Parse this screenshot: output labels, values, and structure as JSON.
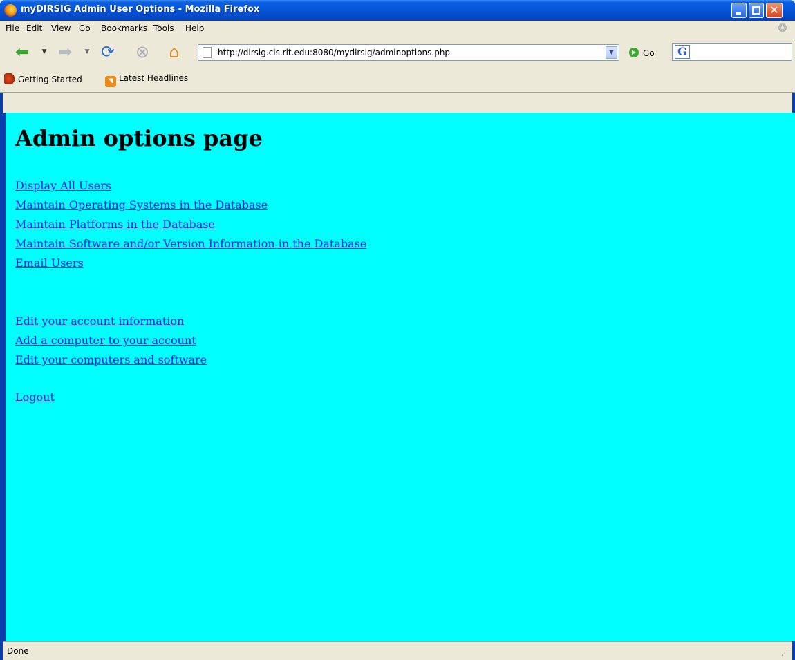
{
  "window": {
    "title": "myDIRSIG Admin User Options - Mozilla Firefox",
    "close_glyph": "✕"
  },
  "menu": {
    "items": [
      {
        "acc": "F",
        "rest": "ile"
      },
      {
        "acc": "E",
        "rest": "dit"
      },
      {
        "acc": "V",
        "rest": "iew"
      },
      {
        "acc": "G",
        "rest": "o"
      },
      {
        "acc": "B",
        "rest": "ookmarks"
      },
      {
        "acc": "T",
        "rest": "ools"
      },
      {
        "acc": "H",
        "rest": "elp"
      }
    ]
  },
  "navigation": {
    "url": "http://dirsig.cis.rit.edu:8080/mydirsig/adminoptions.php",
    "go_label": "Go",
    "search_engine_glyph": "G",
    "search_value": ""
  },
  "bookmarks": [
    {
      "label": "Getting Started"
    },
    {
      "label": "Latest Headlines"
    }
  ],
  "page": {
    "heading": "Admin options page",
    "admin_links": [
      "Display All Users",
      "Maintain Operating Systems in the Database",
      "Maintain Platforms in the Database",
      "Maintain Software and/or Version Information in the Database",
      "Email Users"
    ],
    "account_links": [
      "Edit your account information",
      "Add a computer to your account",
      "Edit your computers and software"
    ],
    "logout": "Logout",
    "background_color": "#00ffff",
    "link_color": "#1a1aee"
  },
  "status": {
    "text": "Done"
  },
  "icons": {
    "app": "firefox-icon",
    "back": "back-arrow-icon",
    "forward": "forward-arrow-icon",
    "reload": "reload-icon",
    "stop": "stop-icon",
    "home": "home-icon",
    "page": "page-icon",
    "go": "go-icon",
    "search_engine": "google-icon",
    "bookmark1": "getting-started-icon",
    "bookmark2": "rss-feed-icon"
  }
}
